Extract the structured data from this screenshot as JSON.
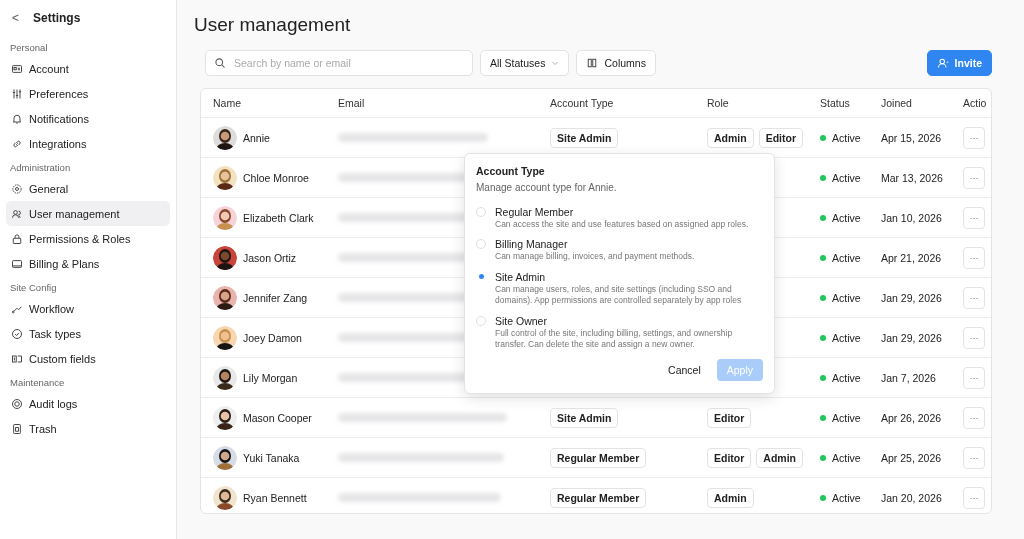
{
  "sidebar": {
    "back": "<",
    "title": "Settings",
    "sections": [
      {
        "label": "Personal",
        "items": [
          {
            "label": "Account",
            "selected": false
          },
          {
            "label": "Preferences",
            "selected": false
          },
          {
            "label": "Notifications",
            "selected": false
          },
          {
            "label": "Integrations",
            "selected": false
          }
        ]
      },
      {
        "label": "Administration",
        "items": [
          {
            "label": "General",
            "selected": false
          },
          {
            "label": "User management",
            "selected": true
          },
          {
            "label": "Permissions & Roles",
            "selected": false
          },
          {
            "label": "Billing & Plans",
            "selected": false
          }
        ]
      },
      {
        "label": "Site Config",
        "items": [
          {
            "label": "Workflow",
            "selected": false
          },
          {
            "label": "Task types",
            "selected": false
          },
          {
            "label": "Custom fields",
            "selected": false
          }
        ]
      },
      {
        "label": "Maintenance",
        "items": [
          {
            "label": "Audit logs",
            "selected": false
          },
          {
            "label": "Trash",
            "selected": false
          }
        ]
      }
    ]
  },
  "page": {
    "title": "User management"
  },
  "toolbar": {
    "search": {
      "placeholder": "Search by name or email"
    },
    "status_filter": "All Statuses",
    "columns_button": "Columns",
    "invite_button": "Invite"
  },
  "table": {
    "columns": [
      "Name",
      "Email",
      "Account Type",
      "Role",
      "Status",
      "Joined",
      "Actio"
    ],
    "rows": [
      {
        "name": "Annie",
        "account_type": "Site Admin",
        "roles": [
          "Admin",
          "Editor"
        ],
        "status": "Active",
        "joined": "Apr 15, 2026",
        "actions": "···"
      },
      {
        "name": "Chloe Monroe",
        "roles": [],
        "status": "Active",
        "joined": "Mar 13, 2026",
        "actions": "···"
      },
      {
        "name": "Elizabeth Clark",
        "roles": [],
        "status": "Active",
        "joined": "Jan 10, 2026",
        "actions": "···"
      },
      {
        "name": "Jason Ortiz",
        "roles": [],
        "status": "Active",
        "joined": "Apr 21, 2026",
        "actions": "···"
      },
      {
        "name": "Jennifer Zang",
        "roles": [],
        "status": "Active",
        "joined": "Jan 29, 2026",
        "actions": "···"
      },
      {
        "name": "Joey Damon",
        "roles": [],
        "status": "Active",
        "joined": "Jan 29, 2026",
        "actions": "···"
      },
      {
        "name": "Lily Morgan",
        "roles": [],
        "status": "Active",
        "joined": "Jan 7, 2026",
        "actions": "···"
      },
      {
        "name": "Mason Cooper",
        "account_type": "Site Admin",
        "roles": [
          "Editor"
        ],
        "status": "Active",
        "joined": "Apr 26, 2026",
        "actions": "···"
      },
      {
        "name": "Yuki Tanaka",
        "account_type": "Regular Member",
        "roles": [
          "Editor",
          "Admin"
        ],
        "status": "Active",
        "joined": "Apr 25, 2026",
        "actions": "···"
      },
      {
        "name": "Ryan Bennett",
        "account_type": "Regular Member",
        "roles": [
          "Admin"
        ],
        "status": "Active",
        "joined": "Jan 20, 2026",
        "actions": "···"
      }
    ]
  },
  "popover": {
    "title": "Account Type",
    "subtitle": "Manage account type for Annie.",
    "options": [
      {
        "label": "Regular Member",
        "description": "Can access the site and use features based on assigned app roles.",
        "selected": false
      },
      {
        "label": "Billing Manager",
        "description": "Can manage billing, invoices, and payment methods.",
        "selected": false
      },
      {
        "label": "Site Admin",
        "description": "Can manage users, roles, and site settings (including SSO and domains). App permissions are controlled separately by app roles",
        "selected": true
      },
      {
        "label": "Site Owner",
        "description": "Full control of the site, including billing, settings, and ownership transfer. Can delete the site and assign a new owner.",
        "selected": false
      }
    ],
    "cancel": "Cancel",
    "apply": {
      "label": "Apply",
      "disabled": true
    }
  }
}
